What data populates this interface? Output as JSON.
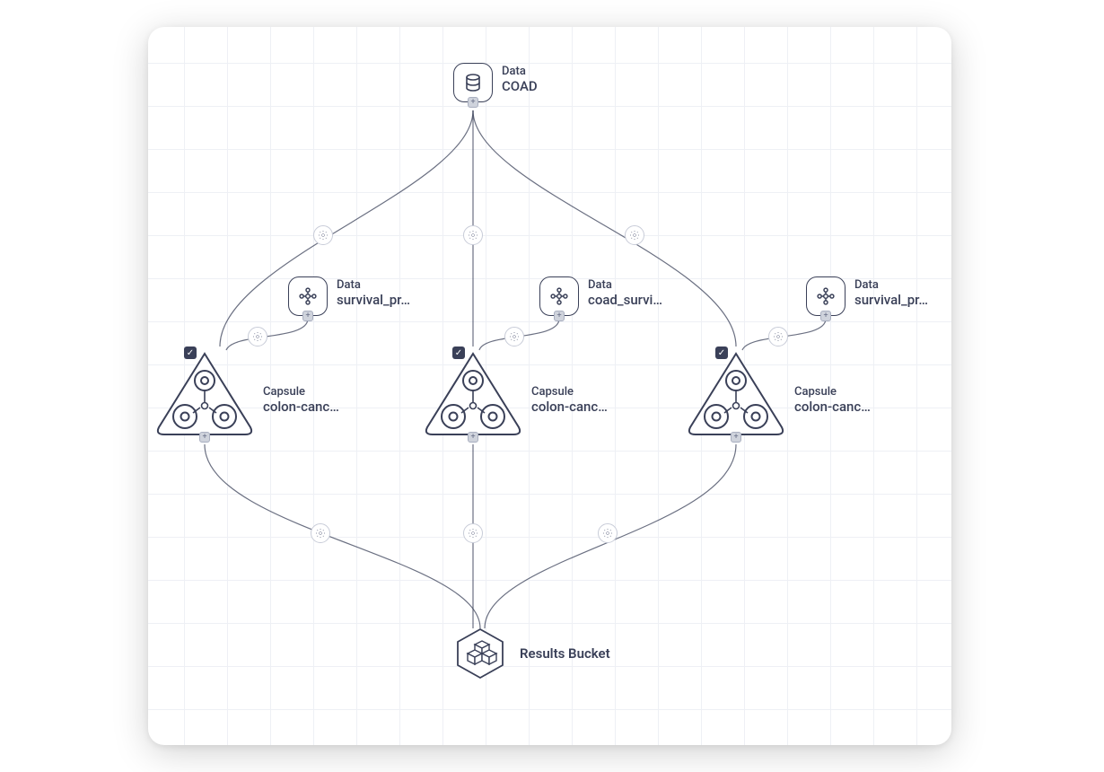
{
  "colors": {
    "stroke": "#3a4058",
    "grid": "#eef0f5",
    "muted": "#6a7089"
  },
  "nodes": {
    "data_coad": {
      "type": "Data",
      "title": "COAD"
    },
    "data_survpr1": {
      "type": "Data",
      "title": "survival_pr…"
    },
    "data_coadsurv": {
      "type": "Data",
      "title": "coad_survi…"
    },
    "data_survpr2": {
      "type": "Data",
      "title": "survival_pr…"
    },
    "capsule1": {
      "type": "Capsule",
      "title": "colon-canc…"
    },
    "capsule2": {
      "type": "Capsule",
      "title": "colon-canc…"
    },
    "capsule3": {
      "type": "Capsule",
      "title": "colon-canc…"
    },
    "results": {
      "title": "Results Bucket"
    }
  },
  "icons": {
    "database": "database-icon",
    "cluster": "cluster-icon",
    "gear": "gear-icon",
    "capsule": "capsule-triangle-icon",
    "boxes": "boxes-icon"
  }
}
